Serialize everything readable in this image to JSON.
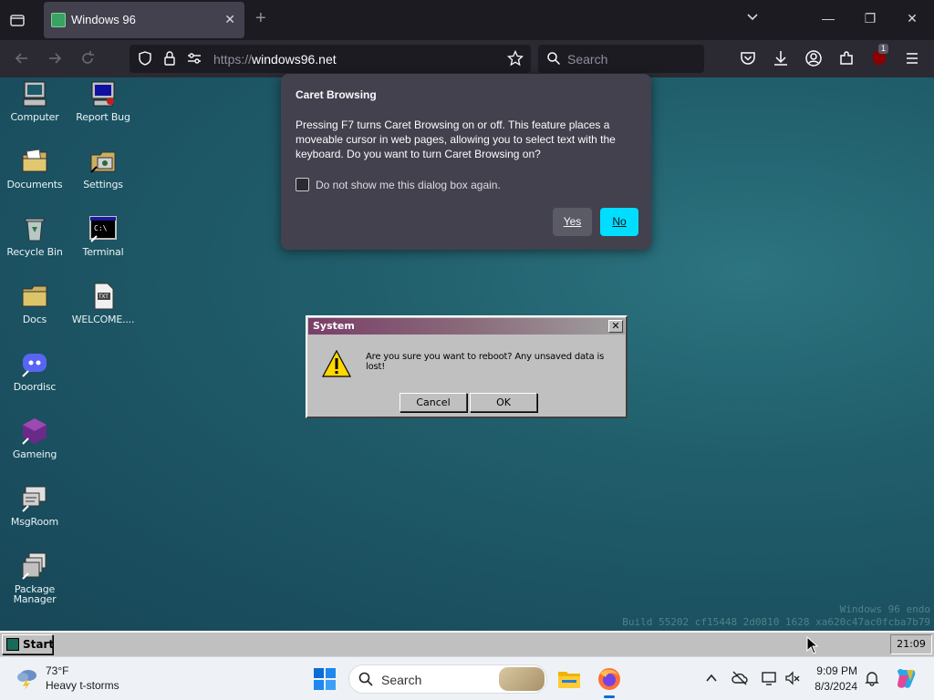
{
  "browser": {
    "tab_title": "Windows 96",
    "url_scheme": "https://",
    "url_host": "windows96.net",
    "search_placeholder": "Search",
    "extension_badge": "1"
  },
  "desktop": {
    "icons": [
      {
        "label": "Computer"
      },
      {
        "label": "Report Bug"
      },
      {
        "label": "Documents"
      },
      {
        "label": "Settings"
      },
      {
        "label": "Recycle Bin"
      },
      {
        "label": "Terminal"
      },
      {
        "label": "Docs"
      },
      {
        "label": "WELCOME...."
      },
      {
        "label": "Doordisc"
      },
      {
        "label": "Gameing"
      },
      {
        "label": "MsgRoom"
      },
      {
        "label": "Package Manager"
      }
    ],
    "build_line1": "Windows 96 endo",
    "build_line2": "Build 55202 cf15448 2d0810 1628 xa620c47ac0fcba7b79"
  },
  "caret_dialog": {
    "title": "Caret Browsing",
    "body": "Pressing F7 turns Caret Browsing on or off. This feature places a moveable cursor in web pages, allowing you to select text with the keyboard. Do you want to turn Caret Browsing on?",
    "checkbox_label": "Do not show me this dialog box again.",
    "yes_label": "Yes",
    "no_label": "No"
  },
  "system_dialog": {
    "title": "System",
    "message": "Are you sure you want to reboot? Any unsaved data is lost!",
    "cancel_label": "Cancel",
    "ok_label": "OK"
  },
  "w96_taskbar": {
    "start_label": "Start",
    "clock": "21:09"
  },
  "win_taskbar": {
    "weather_temp": "73°F",
    "weather_desc": "Heavy t-storms",
    "search_label": "Search",
    "time": "9:09 PM",
    "date": "8/3/2024"
  },
  "colors": {
    "firefox_accent": "#00ddff",
    "w96_face": "#c0c0c0"
  }
}
